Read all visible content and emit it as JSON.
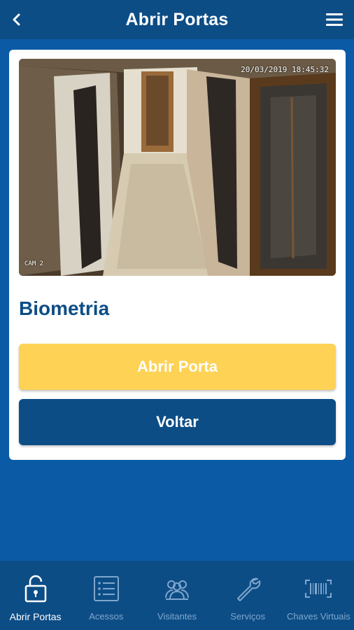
{
  "header": {
    "title": "Abrir Portas",
    "back_icon": "chevron-left-icon",
    "menu_icon": "hamburger-menu-icon"
  },
  "camera": {
    "timestamp": "20/03/2019 18:45:32",
    "label": "CAM 2"
  },
  "main": {
    "section_title": "Biometria",
    "open_button_label": "Abrir Porta",
    "back_button_label": "Voltar"
  },
  "nav": {
    "items": [
      {
        "label": "Abrir Portas",
        "icon": "unlock-icon",
        "active": true
      },
      {
        "label": "Acessos",
        "icon": "list-icon",
        "active": false
      },
      {
        "label": "Visitantes",
        "icon": "people-icon",
        "active": false
      },
      {
        "label": "Serviços",
        "icon": "wrench-icon",
        "active": false
      },
      {
        "label": "Chaves Virtuais",
        "icon": "barcode-icon",
        "active": false
      }
    ]
  },
  "colors": {
    "header": "#0d4d86",
    "background": "#0a5aa6",
    "primary_button": "#fdd255",
    "secondary_button": "#0d4d86",
    "title_text": "#0d4d86"
  }
}
